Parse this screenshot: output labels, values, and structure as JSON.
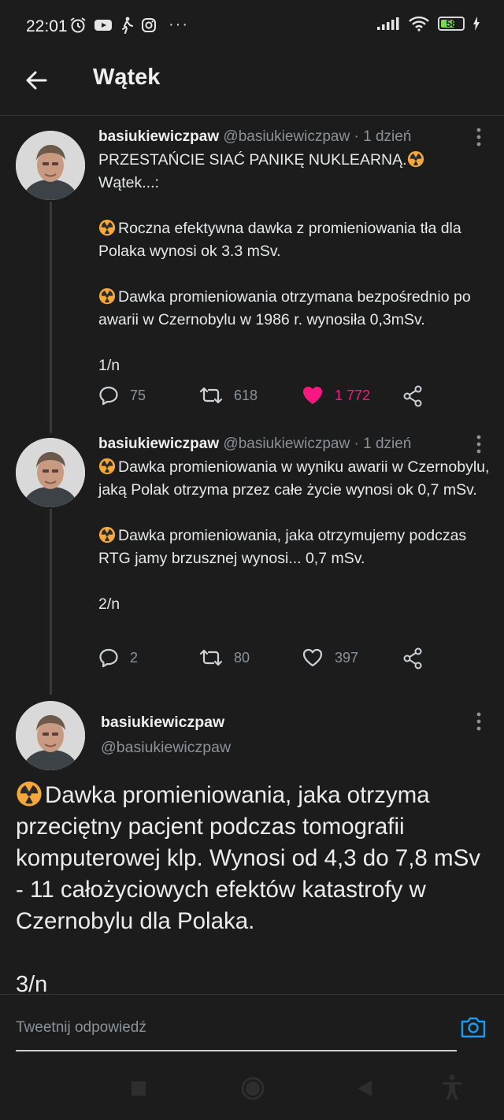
{
  "status_bar": {
    "time": "22:01",
    "battery": "58",
    "icons": [
      "alarm-icon",
      "youtube-icon",
      "walking-icon",
      "instagram-icon",
      "more-dots-icon",
      "signal-icon",
      "wifi-icon",
      "battery-icon",
      "charging-icon"
    ],
    "more": "···"
  },
  "header": {
    "title": "Wątek"
  },
  "tweets": [
    {
      "name": "basiukiewiczpaw",
      "handle": "@basiukiewiczpaw",
      "sep": "·",
      "when": "1 dzień",
      "paragraphs": [
        "PRZESTAŃCIE SIAĆ PANIKĘ NUKLEARNĄ.",
        "Wątek...:",
        "Roczna efektywna dawka z promieniowania tła dla Polaka wynosi ok 3.3 mSv.",
        "Dawka promieniowania otrzymana bezpośrednio po awarii w Czernobylu w 1986 r. wynosiła 0,3mSv.",
        "1/n"
      ],
      "replies": "75",
      "retweets": "618",
      "likes": "1 772",
      "liked": true
    },
    {
      "name": "basiukiewiczpaw",
      "handle": "@basiukiewiczpaw",
      "sep": "·",
      "when": "1 dzień",
      "paragraphs": [
        "Dawka promieniowania w wyniku awarii w Czernobylu, jaką Polak otrzyma przez całe życie wynosi ok 0,7 mSv.",
        "Dawka promieniowania, jaka otrzymujemy podczas RTG jamy brzusznej wynosi... 0,7 mSv.",
        "2/n"
      ],
      "replies": "2",
      "retweets": "80",
      "likes": "397",
      "liked": false
    }
  ],
  "focused": {
    "name": "basiukiewiczpaw",
    "handle": "@basiukiewiczpaw",
    "text": "Dawka promieniowania, jaka otrzyma przeciętny pacjent podczas tomografii komputerowej klp. Wynosi od 4,3 do 7,8 mSv - 11 całożyciowych efektów katastrofy w Czernobylu dla Polaka.",
    "counter": "3/n"
  },
  "reply": {
    "placeholder": "Tweetnij odpowiedź"
  },
  "colors": {
    "background": "#1c1c1c",
    "like": "#f91880",
    "accent": "#1d9bf0",
    "muted": "#8b9298"
  }
}
